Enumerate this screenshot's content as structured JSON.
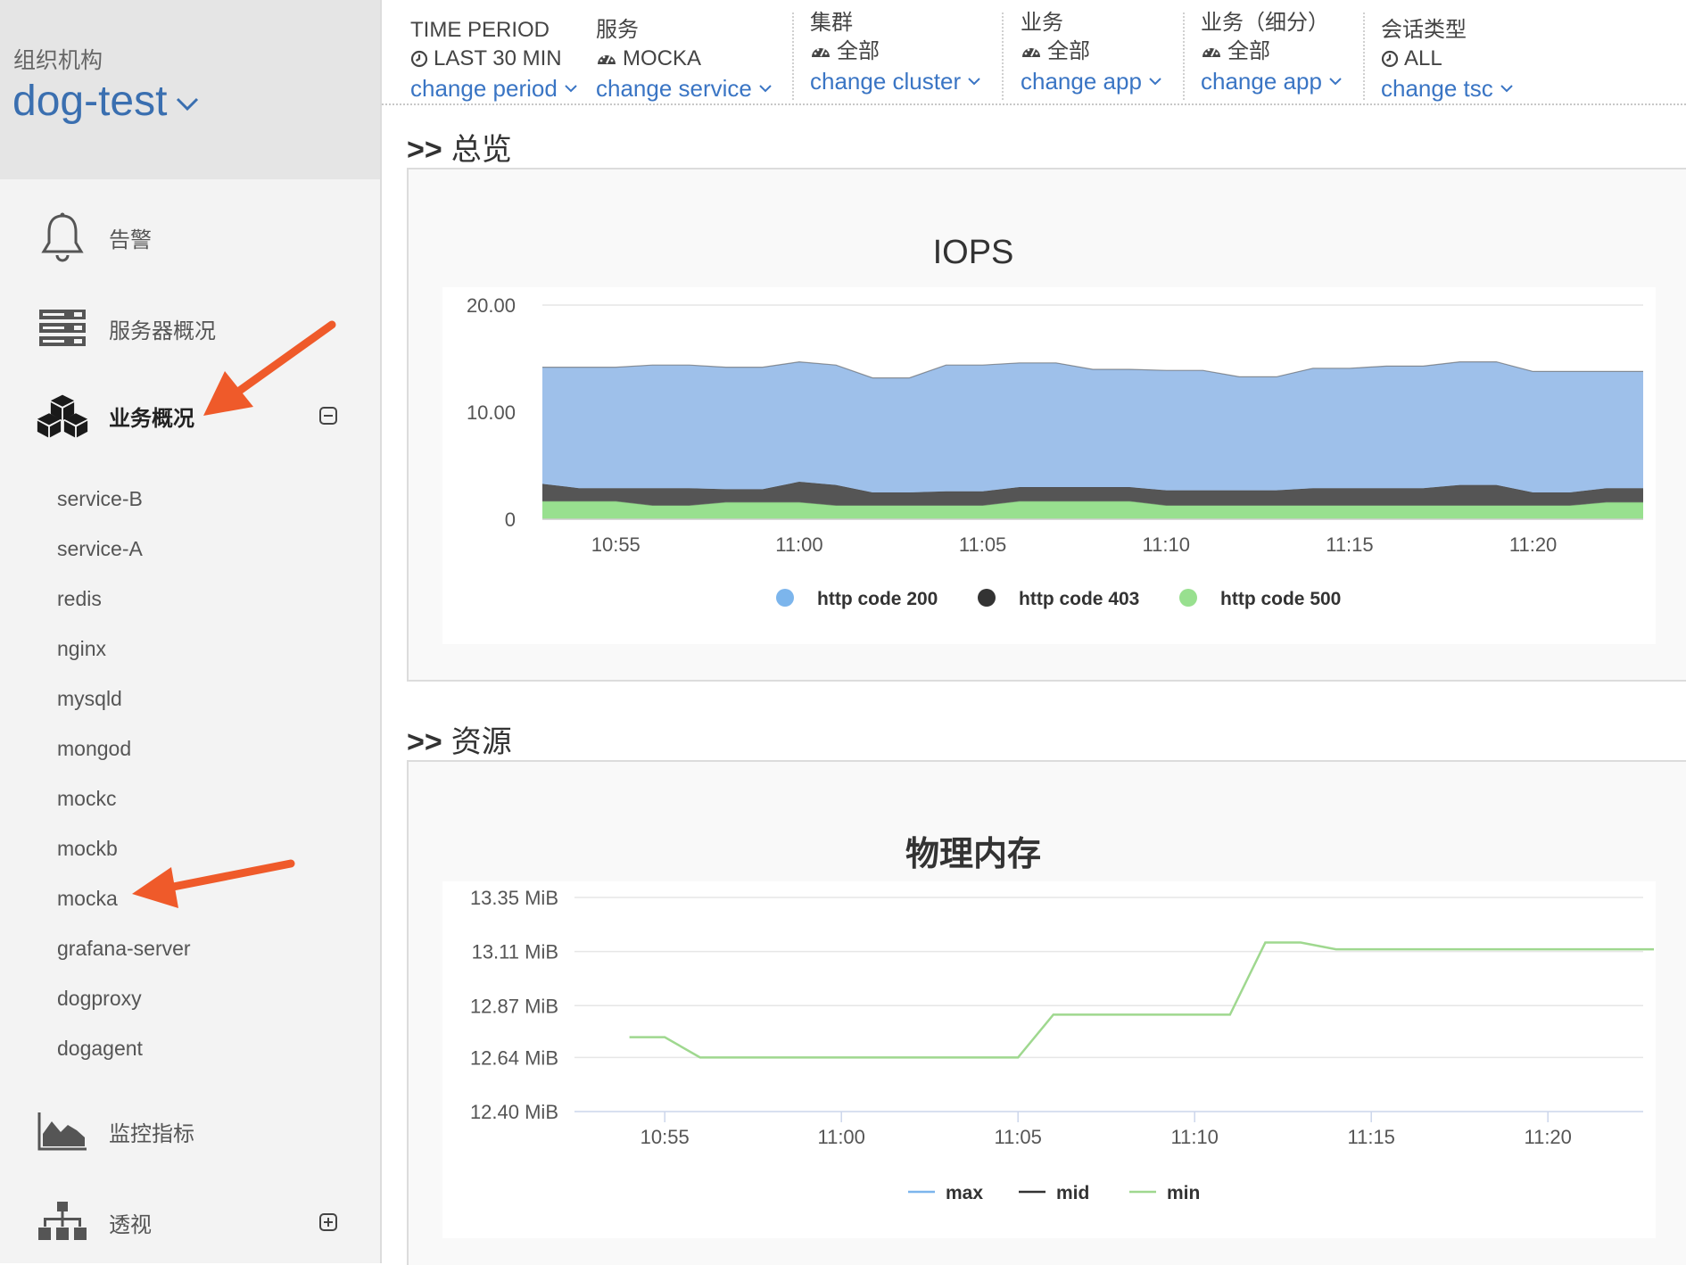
{
  "sidebar": {
    "org_label": "组织机构",
    "org_name": "dog-test",
    "nav": {
      "alerts": "告警",
      "servers": "服务器概况",
      "business": "业务概况",
      "metrics": "监控指标",
      "perspective": "透视"
    },
    "services": [
      "service-B",
      "service-A",
      "redis",
      "nginx",
      "mysqld",
      "mongod",
      "mockc",
      "mockb",
      "mocka",
      "grafana-server",
      "dogproxy",
      "dogagent"
    ]
  },
  "filters": [
    {
      "title": "TIME PERIOD",
      "value": "LAST 30 MIN",
      "icon": "clock-icon",
      "link": "change period"
    },
    {
      "title": "服务",
      "value": "MOCKA",
      "icon": "gauge-icon",
      "link": "change service"
    },
    {
      "title": "集群",
      "value": "全部",
      "icon": "gauge-icon",
      "link": "change cluster"
    },
    {
      "title": "业务",
      "value": "全部",
      "icon": "gauge-icon",
      "link": "change app"
    },
    {
      "title": "业务（细分）",
      "value": "全部",
      "icon": "gauge-icon",
      "link": "change app"
    },
    {
      "title": "会话类型",
      "value": "ALL",
      "icon": "clock-icon",
      "link": "change tsc"
    }
  ],
  "sections": {
    "overview": "总览",
    "resources": "资源",
    "prefix": ">>"
  },
  "colors": {
    "accent": "#3a75c4",
    "http200": "#9ec0ea",
    "http403": "#555555",
    "http500": "#98e08f",
    "min_line": "#9fd88f",
    "arrow": "#ef5a2a"
  },
  "chart_data": [
    {
      "type": "area",
      "stacked": true,
      "title": "IOPS",
      "x": [
        "10:53",
        "10:54",
        "10:55",
        "10:56",
        "10:57",
        "10:58",
        "10:59",
        "11:00",
        "11:01",
        "11:02",
        "11:03",
        "11:04",
        "11:05",
        "11:06",
        "11:07",
        "11:08",
        "11:09",
        "11:10",
        "11:11",
        "11:12",
        "11:13",
        "11:14",
        "11:15",
        "11:16",
        "11:17",
        "11:18",
        "11:19",
        "11:20",
        "11:21",
        "11:22",
        "11:23"
      ],
      "x_ticks": [
        "10:55",
        "11:00",
        "11:05",
        "11:10",
        "11:15",
        "11:20"
      ],
      "y_ticks": [
        "20.00",
        "10.00",
        "0"
      ],
      "ylim": [
        0,
        20
      ],
      "grid": true,
      "legend_position": "bottom",
      "series": [
        {
          "name": "http code 500",
          "color": "#98e08f",
          "values": [
            1.7,
            1.7,
            1.7,
            1.3,
            1.3,
            1.6,
            1.6,
            1.6,
            1.3,
            1.3,
            1.3,
            1.3,
            1.3,
            1.7,
            1.7,
            1.7,
            1.7,
            1.3,
            1.3,
            1.3,
            1.3,
            1.3,
            1.3,
            1.3,
            1.3,
            1.3,
            1.3,
            1.3,
            1.3,
            1.6,
            1.6
          ]
        },
        {
          "name": "http code 403",
          "color": "#555555",
          "values": [
            1.6,
            1.2,
            1.2,
            1.6,
            1.6,
            1.2,
            1.2,
            1.9,
            1.9,
            1.2,
            1.2,
            1.3,
            1.3,
            1.3,
            1.3,
            1.3,
            1.3,
            1.4,
            1.4,
            1.4,
            1.4,
            1.6,
            1.6,
            1.6,
            1.6,
            1.9,
            1.9,
            1.2,
            1.2,
            1.3,
            1.3
          ]
        },
        {
          "name": "http code 200",
          "color": "#9ec0ea",
          "values": [
            10.9,
            11.3,
            11.3,
            11.5,
            11.5,
            11.4,
            11.4,
            11.2,
            11.2,
            10.7,
            10.7,
            11.8,
            11.8,
            11.6,
            11.6,
            11.0,
            11.0,
            11.2,
            11.2,
            10.6,
            10.6,
            11.2,
            11.2,
            11.4,
            11.4,
            11.5,
            11.5,
            11.3,
            11.3,
            10.9,
            10.9
          ]
        }
      ]
    },
    {
      "type": "line",
      "title": "物理内存",
      "x": [
        "10:54",
        "10:55",
        "10:56",
        "10:57",
        "10:58",
        "10:59",
        "11:00",
        "11:01",
        "11:02",
        "11:03",
        "11:04",
        "11:05",
        "11:06",
        "11:07",
        "11:08",
        "11:09",
        "11:10",
        "11:11",
        "11:12",
        "11:13",
        "11:14",
        "11:15",
        "11:16",
        "11:17",
        "11:18",
        "11:19",
        "11:20",
        "11:21",
        "11:22",
        "11:23"
      ],
      "x_ticks": [
        "10:55",
        "11:00",
        "11:05",
        "11:10",
        "11:15",
        "11:20"
      ],
      "y_ticks": [
        "13.35 MiB",
        "13.11 MiB",
        "12.87 MiB",
        "12.64 MiB",
        "12.40 MiB"
      ],
      "ylim": [
        12.4,
        13.35
      ],
      "grid": true,
      "legend_position": "bottom",
      "series": [
        {
          "name": "max",
          "color": "#7cb5ec",
          "values": []
        },
        {
          "name": "mid",
          "color": "#333333",
          "values": []
        },
        {
          "name": "min",
          "color": "#9fd88f",
          "values": [
            12.73,
            12.73,
            12.64,
            12.64,
            12.64,
            12.64,
            12.64,
            12.64,
            12.64,
            12.64,
            12.64,
            12.64,
            12.83,
            12.83,
            12.83,
            12.83,
            12.83,
            12.83,
            13.15,
            13.15,
            13.12,
            13.12,
            13.12,
            13.12,
            13.12,
            13.12,
            13.12,
            13.12,
            13.12,
            13.12
          ]
        }
      ]
    }
  ]
}
